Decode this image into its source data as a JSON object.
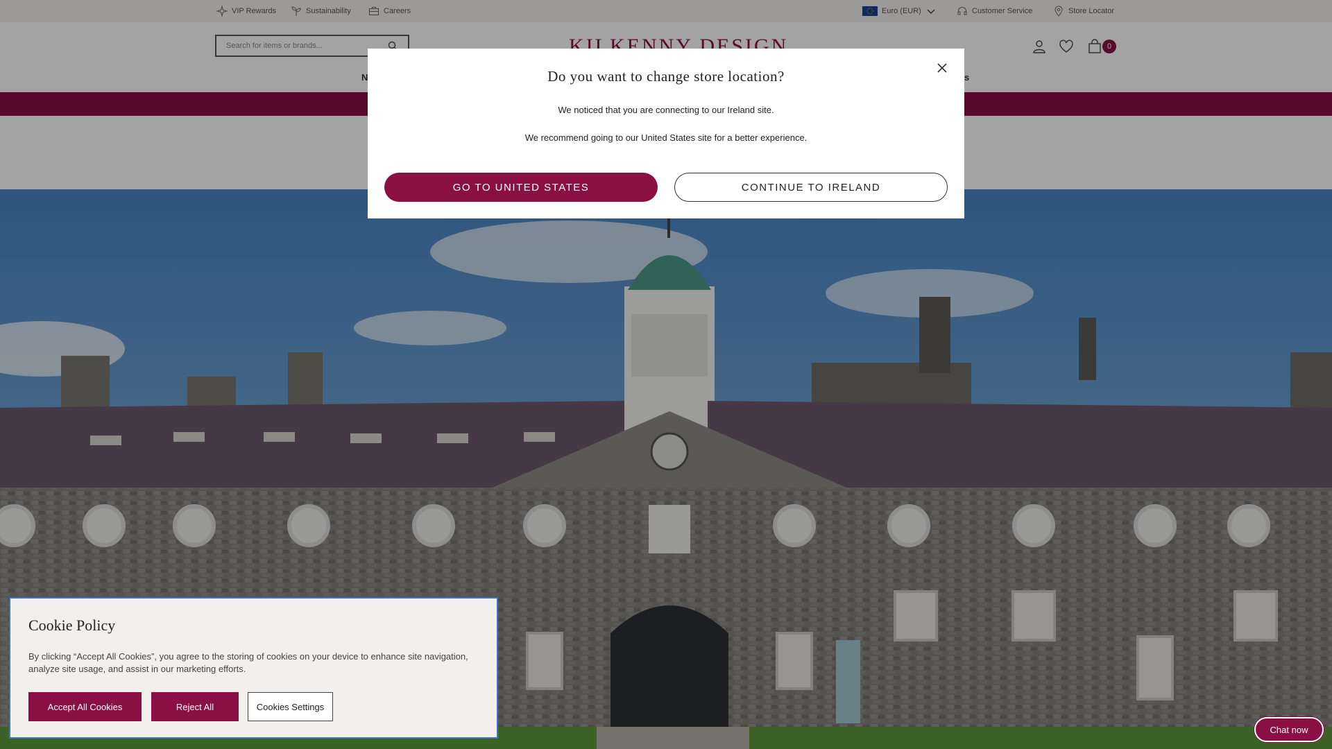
{
  "topbar": {
    "vip_rewards": "VIP Rewards",
    "sustainability": "Sustainability",
    "careers": "Careers",
    "currency": "Euro (EUR)",
    "customer_service": "Customer Service",
    "store_locator": "Store Locator"
  },
  "header": {
    "search_placeholder": "Search for items or brands...",
    "logo": "KILKENNY DESIGN",
    "nav_fragment_left": "N",
    "nav_fragment_right": "s",
    "cart_count": "0"
  },
  "modal": {
    "title": "Do you want to change store location?",
    "line1": "We noticed that you are connecting to our Ireland site.",
    "line2": "We recommend going to our United States site for a better experience.",
    "go_button": "GO TO UNITED STATES",
    "continue_button": "CONTINUE TO IRELAND"
  },
  "cookie": {
    "title": "Cookie Policy",
    "text": "By clicking “Accept All Cookies”, you agree to the storing of cookies on your device to enhance site navigation, analyze site usage, and assist in our marketing efforts.",
    "accept": "Accept All Cookies",
    "reject": "Reject All",
    "settings": "Cookies Settings"
  },
  "chat": {
    "label": "Chat now"
  },
  "colors": {
    "brand": "#8a0f45",
    "cookie_border": "#3b74c9"
  },
  "icons": [
    "sparkle-icon",
    "plant-icon",
    "briefcase-icon",
    "eu-flag-icon",
    "chevron-down-icon",
    "headset-icon",
    "location-pin-icon",
    "search-icon",
    "user-icon",
    "heart-icon",
    "bag-icon",
    "close-icon"
  ]
}
